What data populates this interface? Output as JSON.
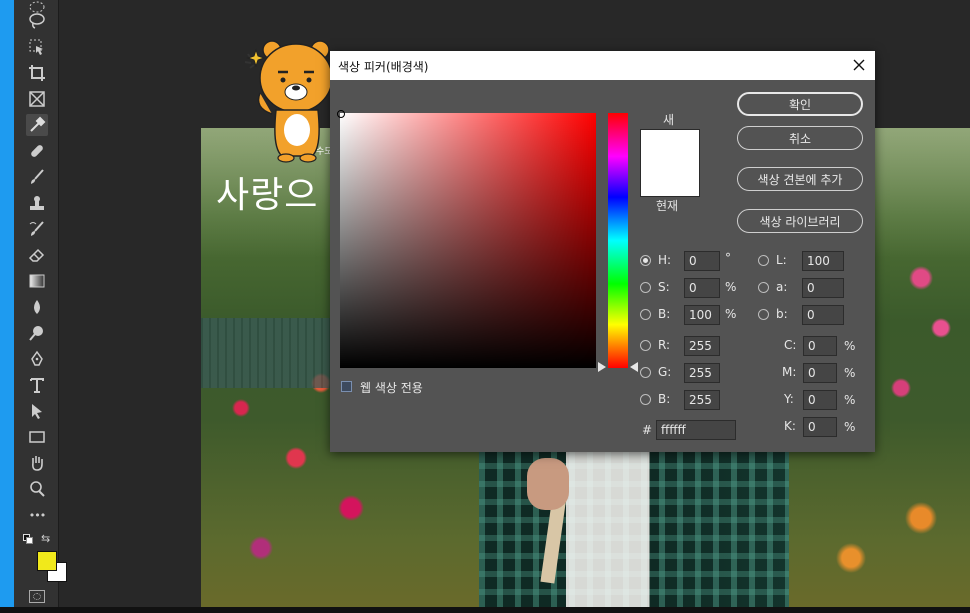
{
  "dialog": {
    "title": "색상 피커(배경색)",
    "preview_new_label": "새",
    "preview_current_label": "현재",
    "buttons": {
      "ok": "확인",
      "cancel": "취소",
      "add_to_swatches": "색상 견본에 추가",
      "color_libraries": "색상 라이브러리"
    },
    "web_colors_only_label": "웹 색상 전용",
    "fields": {
      "H": {
        "label": "H:",
        "value": "0",
        "unit": "°"
      },
      "S": {
        "label": "S:",
        "value": "0",
        "unit": "%"
      },
      "B": {
        "label": "B:",
        "value": "100",
        "unit": "%"
      },
      "R": {
        "label": "R:",
        "value": "255"
      },
      "G": {
        "label": "G:",
        "value": "255"
      },
      "Bl": {
        "label": "B:",
        "value": "255"
      },
      "L": {
        "label": "L:",
        "value": "100"
      },
      "a": {
        "label": "a:",
        "value": "0"
      },
      "b": {
        "label": "b:",
        "value": "0"
      },
      "C": {
        "label": "C:",
        "value": "0",
        "unit": "%"
      },
      "M": {
        "label": "M:",
        "value": "0",
        "unit": "%"
      },
      "Y": {
        "label": "Y:",
        "value": "0",
        "unit": "%"
      },
      "K": {
        "label": "K:",
        "value": "0",
        "unit": "%"
      },
      "hex": {
        "label": "#",
        "value": "ffffff"
      }
    },
    "selected_mode": "H",
    "colors": {
      "new": "#ffffff",
      "current": "#ffffff"
    }
  },
  "canvas": {
    "title_text": "사랑으",
    "small_text": "수도"
  },
  "toolbar": {
    "foreground_color": "#f1e91b",
    "background_color": "#ffffff",
    "more_label": "•••"
  }
}
